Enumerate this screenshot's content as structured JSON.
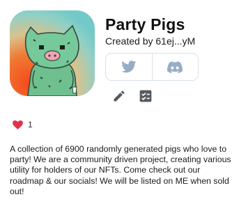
{
  "collection": {
    "name": "Party Pigs",
    "creator_text": "Created by 61ej...yM",
    "avatar_icon": "party-pig-avatar",
    "description": "A collection of 6900 randomly generated pigs who love to party! We are a community driven project, creating various utility for holders of our NFTs. Come check out our roadmap & our socials! We will be listed on ME when sold out!"
  },
  "socials": [
    {
      "name": "twitter",
      "icon": "twitter-icon",
      "color": "#97adc4"
    },
    {
      "name": "discord",
      "icon": "discord-icon",
      "color": "#97adc4"
    }
  ],
  "tools": [
    {
      "name": "edit",
      "icon": "pencil-icon"
    },
    {
      "name": "checklist",
      "icon": "checklist-icon"
    }
  ],
  "likes": {
    "icon": "heart-icon",
    "count": "1",
    "color": "#e0334a"
  }
}
